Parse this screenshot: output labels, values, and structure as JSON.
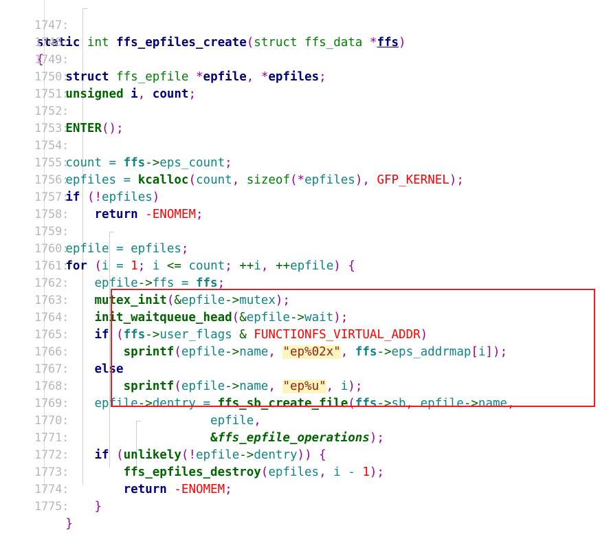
{
  "viewer": {
    "kind": "source-code-viewer",
    "language": "C",
    "function_name": "ffs_epfiles_create",
    "first_line_number": 1747,
    "last_line_number": 1775,
    "line_number_suffix": ":",
    "background_color": "#ffffff",
    "line_number_color": "#b8b8b8",
    "annotation_box_color": "#ed1c24",
    "search_highlight_color": "#fbf6bd",
    "search_highlight_terms": [
      "\"ep%02x\"",
      "\"ep%u\""
    ]
  },
  "lines": [
    {
      "n": "1747",
      "text": "static int ffs_epfiles_create(struct ffs_data *ffs)"
    },
    {
      "n": "1748",
      "text": "{"
    },
    {
      "n": "1749",
      "text": "    struct ffs_epfile *epfile, *epfiles;"
    },
    {
      "n": "1750",
      "text": "    unsigned i, count;"
    },
    {
      "n": "1751",
      "text": ""
    },
    {
      "n": "1752",
      "text": "    ENTER();"
    },
    {
      "n": "1753",
      "text": ""
    },
    {
      "n": "1754",
      "text": "    count = ffs->eps_count;"
    },
    {
      "n": "1755",
      "text": "    epfiles = kcalloc(count, sizeof(*epfiles), GFP_KERNEL);"
    },
    {
      "n": "1756",
      "text": "    if (!epfiles)"
    },
    {
      "n": "1757",
      "text": "        return -ENOMEM;"
    },
    {
      "n": "1758",
      "text": ""
    },
    {
      "n": "1759",
      "text": "    epfile = epfiles;"
    },
    {
      "n": "1760",
      "text": "    for (i = 1; i <= count; ++i, ++epfile) {"
    },
    {
      "n": "1761",
      "text": "        epfile->ffs = ffs;"
    },
    {
      "n": "1762",
      "text": "        mutex_init(&epfile->mutex);"
    },
    {
      "n": "1763",
      "text": "        init_waitqueue_head(&epfile->wait);"
    },
    {
      "n": "1764",
      "text": "        if (ffs->user_flags & FUNCTIONFS_VIRTUAL_ADDR)"
    },
    {
      "n": "1765",
      "text": "            sprintf(epfile->name, \"ep%02x\", ffs->eps_addrmap[i]);"
    },
    {
      "n": "1766",
      "text": "        else"
    },
    {
      "n": "1767",
      "text": "            sprintf(epfile->name, \"ep%u\", i);"
    },
    {
      "n": "1768",
      "text": "        epfile->dentry = ffs_sb_create_file(ffs->sb, epfile->name,"
    },
    {
      "n": "1769",
      "text": "                        epfile,"
    },
    {
      "n": "1770",
      "text": "                        &ffs_epfile_operations);"
    },
    {
      "n": "1771",
      "text": "        if (unlikely(!epfile->dentry)) {"
    },
    {
      "n": "1772",
      "text": "            ffs_epfiles_destroy(epfiles, i - 1);"
    },
    {
      "n": "1773",
      "text": "            return -ENOMEM;"
    },
    {
      "n": "1774",
      "text": "        }"
    },
    {
      "n": "1775",
      "text": "    }"
    }
  ],
  "line_numbers": {
    "l1747": "1747:",
    "l1748": "1748:",
    "l1749": "1749:",
    "l1750": "1750:",
    "l1751": "1751:",
    "l1752": "1752:",
    "l1753": "1753:",
    "l1754": "1754:",
    "l1755": "1755:",
    "l1756": "1756:",
    "l1757": "1757:",
    "l1758": "1758:",
    "l1759": "1759:",
    "l1760": "1760:",
    "l1761": "1761:",
    "l1762": "1762:",
    "l1763": "1763:",
    "l1764": "1764:",
    "l1765": "1765:",
    "l1766": "1766:",
    "l1767": "1767:",
    "l1768": "1768:",
    "l1769": "1769:",
    "l1770": "1770:",
    "l1771": "1771:",
    "l1772": "1772:",
    "l1773": "1773:",
    "l1774": "1774:",
    "l1775": "1775:"
  },
  "tokens": {
    "kw_static": "static",
    "kw_int": "int",
    "kw_struct": "struct",
    "kw_unsigned": "unsigned",
    "kw_if": "if",
    "kw_else": "else",
    "kw_for": "for",
    "kw_return": "return",
    "kw_sizeof": "sizeof",
    "fn_ffs_epfiles_create": "ffs_epfiles_create",
    "type_ffs_data": "ffs_data",
    "type_ffs_epfile": "ffs_epfile",
    "var_ffs": "ffs",
    "var_epfile": "epfile",
    "var_epfiles": "epfiles",
    "var_i": "i",
    "var_count": "count",
    "var_eps_count": "eps_count",
    "var_user_flags": "user_flags",
    "var_eps_addrmap": "eps_addrmap",
    "var_name": "name",
    "var_dentry": "dentry",
    "var_mutex": "mutex",
    "var_wait": "wait",
    "var_sb": "sb",
    "call_ENTER": "ENTER",
    "call_kcalloc": "kcalloc",
    "call_mutex_init": "mutex_init",
    "call_init_waitqueue_head": "init_waitqueue_head",
    "call_sprintf": "sprintf",
    "call_ffs_sb_create_file": "ffs_sb_create_file",
    "call_unlikely": "unlikely",
    "call_ffs_epfiles_destroy": "ffs_epfiles_destroy",
    "ident_ffs_epfile_operations": "ffs_epfile_operations",
    "macro_GFP_KERNEL": "GFP_KERNEL",
    "macro_ENOMEM": "ENOMEM",
    "macro_FUNCTIONFS_VIRTUAL_ADDR": "FUNCTIONFS_VIRTUAL_ADDR",
    "str_ep02x": "\"ep%02x\"",
    "str_epu": "\"ep%u\"",
    "num_one": "1",
    "brace_open": "{",
    "brace_close": "}",
    "paren_open": "(",
    "paren_close": ")",
    "paren_close2": "))",
    "paren_close_semi": ");",
    "semi": ";",
    "comma": ",",
    "comma_sp": ", ",
    "star": "*",
    "star_comma": ", *",
    "amp": "&",
    "bang": "!",
    "arrow": "->",
    "assign": " = ",
    "minus": "-",
    "le": " <= ",
    "inc": "++",
    "bitand": " & ",
    "minus_one": " - ",
    "space": " ",
    "sp4": "    ",
    "sp8": "        ",
    "sp12": "            ",
    "sp24": "                        "
  }
}
